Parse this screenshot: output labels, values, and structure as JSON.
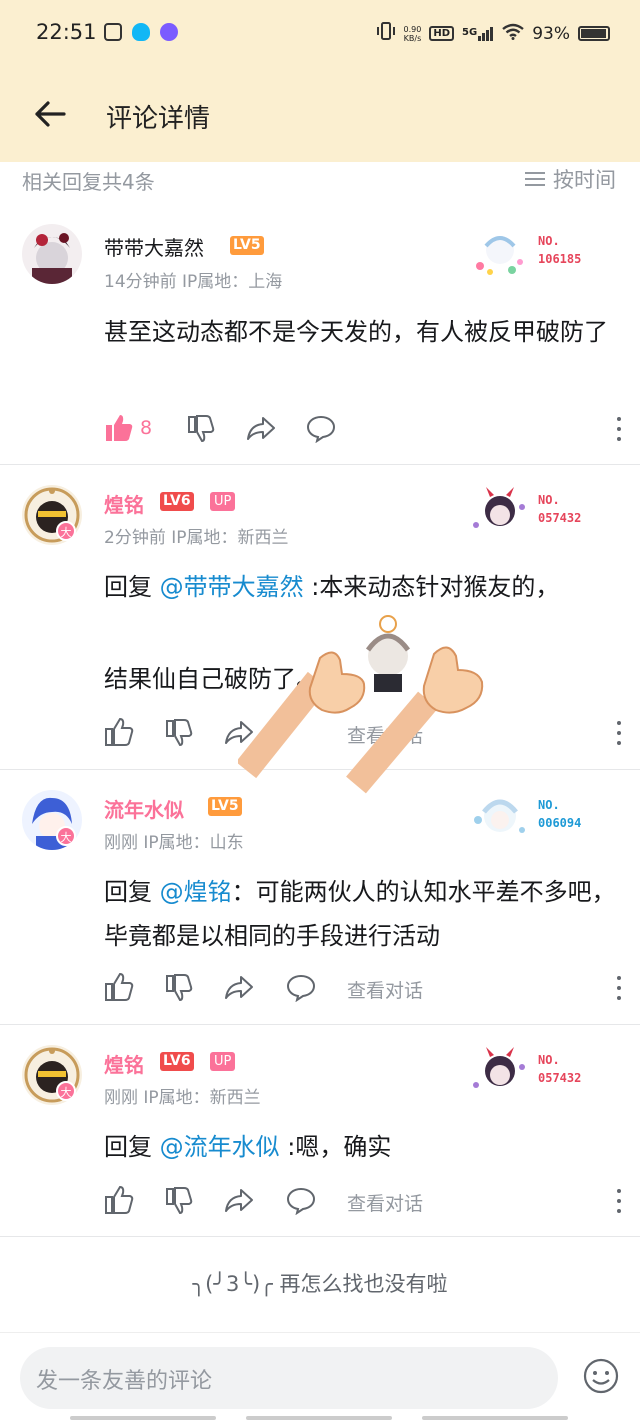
{
  "status_bar": {
    "time": "22:51",
    "net_speed_value": "0.90",
    "net_speed_unit": "KB/s",
    "hd": "HD",
    "signal": "5G",
    "battery": "93%"
  },
  "header": {
    "title": "评论详情",
    "back_icon": "arrow-left-icon"
  },
  "subheader": {
    "reply_count": "相关回复共4条",
    "sort_label": "按时间"
  },
  "comments": [
    {
      "username": "带带大嘉然",
      "username_color": "#61666d",
      "level": "LV5",
      "level_color": "#ff9b3c",
      "up": "",
      "meta": "14分钟前  IP属地：上海",
      "fan_no": [
        "NO.",
        "106185"
      ],
      "mention": "",
      "text": "甚至这动态都不是今天发的，有人被反甲破防了",
      "likes": "8",
      "liked": true,
      "view_conversation": ""
    },
    {
      "username": "煌铭",
      "username_color": "#fb7299",
      "level": "LV6",
      "level_color": "#f04c4c",
      "up": "UP",
      "meta": "2分钟前  IP属地：新西兰",
      "fan_no": [
        "NO.",
        "057432"
      ],
      "reply_prefix": "回复 ",
      "mention": "@带带大嘉然",
      "text_line1": " :本来动态针对猴友的，",
      "text_line2": "结果仙自己破防了。",
      "view_conversation": "查看对话"
    },
    {
      "username": "流年水似",
      "username_color": "#fb7299",
      "level": "LV5",
      "level_color": "#ff9b3c",
      "up": "",
      "meta": "刚刚  IP属地：山东",
      "fan_no": [
        "NO.",
        "006094"
      ],
      "reply_prefix": "回复 ",
      "mention": "@煌铭",
      "text": "：可能两伙人的认知水平差不多吧，毕竟都是以相同的手段进行活动",
      "view_conversation": "查看对话"
    },
    {
      "username": "煌铭",
      "username_color": "#fb7299",
      "level": "LV6",
      "level_color": "#f04c4c",
      "up": "UP",
      "meta": "刚刚  IP属地：新西兰",
      "fan_no": [
        "NO.",
        "057432"
      ],
      "reply_prefix": "回复 ",
      "mention": "@流年水似",
      "text": " :嗯，确实",
      "view_conversation": "查看对话"
    }
  ],
  "end_note": {
    "kaomoji": "╮(╯3╰)╭",
    "text": "再怎么找也没有啦"
  },
  "input": {
    "placeholder": "发一条友善的评论",
    "emoji_icon": "smiley-icon"
  },
  "colors": {
    "header_bg": "#fbefd0",
    "accent_pink": "#fb7299",
    "link_blue": "#178bcf",
    "muted": "#9499a0"
  }
}
